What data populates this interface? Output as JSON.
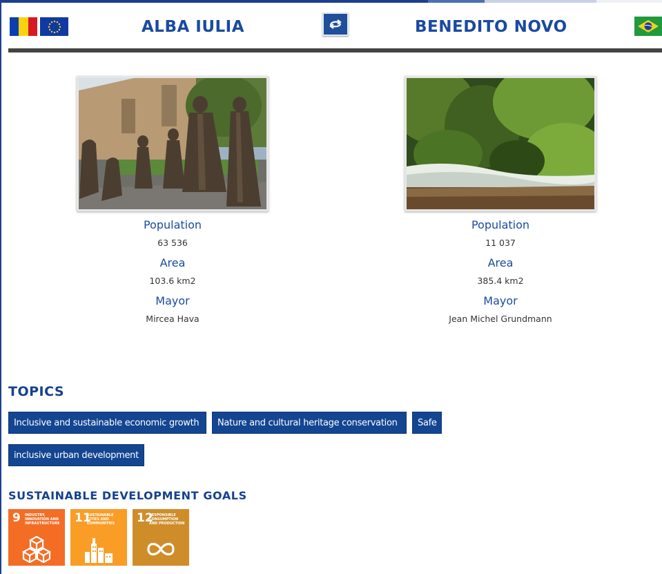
{
  "colors": {
    "accent_blue": "#1a4aa0",
    "tag_bg": "#144591",
    "divider": "#444444",
    "sdg_9": "#f36d25",
    "sdg_11": "#f99d26",
    "sdg_12": "#cf8d2a"
  },
  "header": {
    "left_city": "ALBA IULIA",
    "right_city": "BENEDITO NOVO",
    "left_flags": [
      "romania-flag-icon",
      "eu-flag-icon"
    ],
    "right_flag": "brazil-flag-icon",
    "swap_icon": "swap-icon"
  },
  "left_city": {
    "photo_icon": "city-photo",
    "population_label": "Population",
    "population": "63 536",
    "area_label": "Area",
    "area": "103.6 km2",
    "mayor_label": "Mayor",
    "mayor": "Mircea Hava"
  },
  "right_city": {
    "photo_icon": "city-photo",
    "population_label": "Population",
    "population": "11 037",
    "area_label": "Area",
    "area": "385.4 km2",
    "mayor_label": "Mayor",
    "mayor": "Jean Michel Grundmann"
  },
  "topics": {
    "title": "TOPICS",
    "tags": [
      "Inclusive and sustainable economic growth",
      "Nature and cultural heritage conservation",
      "Safe",
      "inclusive urban development"
    ]
  },
  "sdg": {
    "title": "SUSTAINABLE DEVELOPMENT GOALS",
    "goals": [
      {
        "number": "9",
        "text": "INDUSTRY, INNOVATION AND INFRASTRUCTURE",
        "icon": "cubes-icon"
      },
      {
        "number": "11",
        "text": "SUSTAINABLE CITIES AND COMMUNITIES",
        "icon": "city-buildings-icon"
      },
      {
        "number": "12",
        "text": "RESPONSIBLE CONSUMPTION AND PRODUCTION",
        "icon": "infinity-icon"
      }
    ]
  }
}
